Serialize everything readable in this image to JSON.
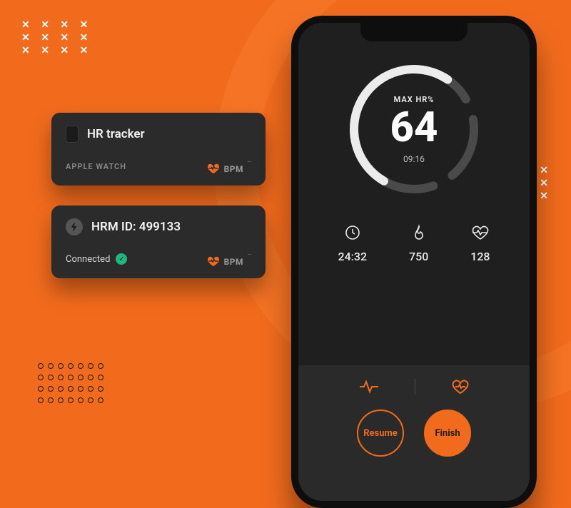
{
  "cards": [
    {
      "title": "HR tracker",
      "subtitle": "APPLE WATCH",
      "bpm_label": "BPM",
      "bpm_value": "--"
    },
    {
      "title": "HRM ID: 499133",
      "status_text": "Connected",
      "bpm_label": "BPM",
      "bpm_value": "--"
    }
  ],
  "phone": {
    "dial": {
      "label": "MAX HR%",
      "value": "64",
      "elapsed": "09:16"
    },
    "stats": {
      "time": "24:32",
      "calories": "750",
      "bpm": "128"
    },
    "buttons": {
      "resume": "Resume",
      "finish": "Finish"
    }
  },
  "colors": {
    "accent": "#F26B1D"
  }
}
